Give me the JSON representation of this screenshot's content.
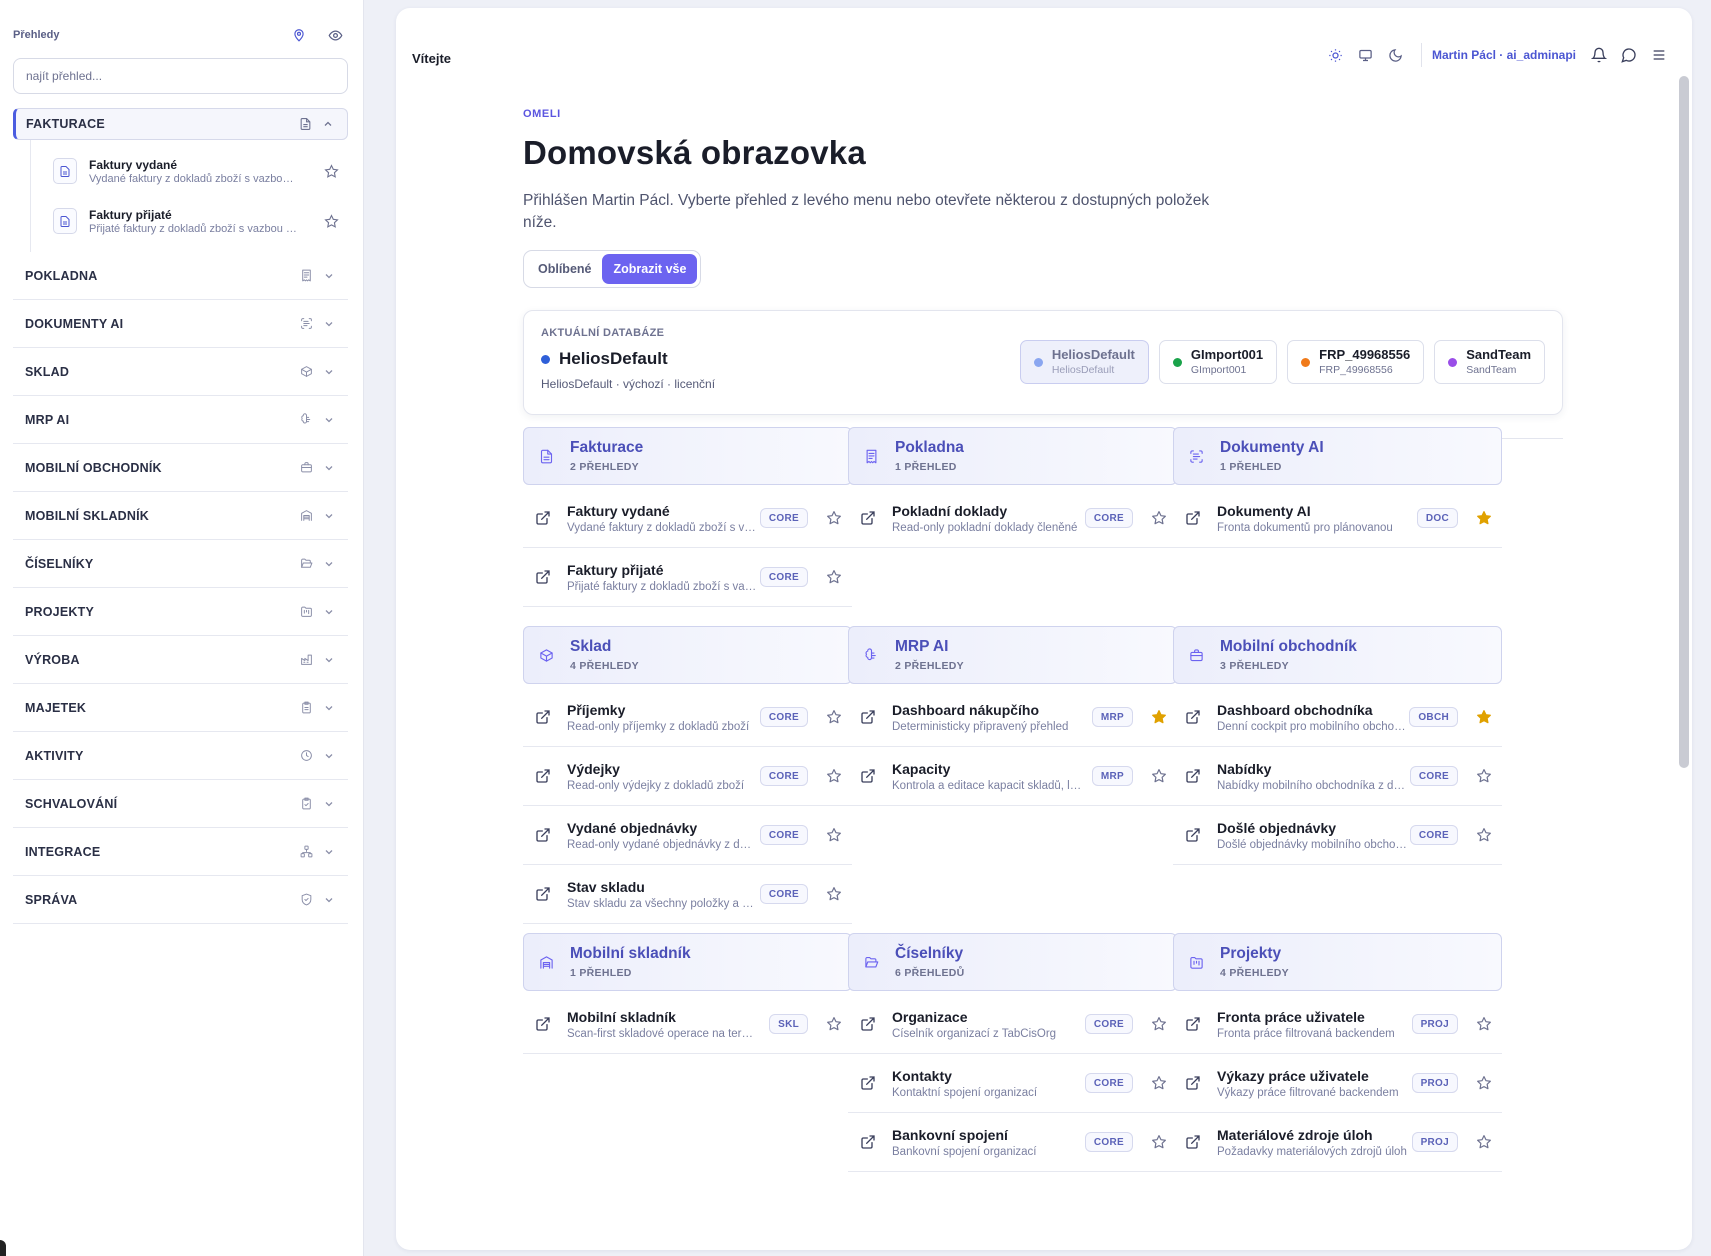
{
  "sidebar": {
    "title": "Přehledy",
    "search_placeholder": "najít přehled...",
    "open_group": {
      "label": "FAKTURACE",
      "items": [
        {
          "title": "Faktury vydané",
          "desc": "Vydané faktury z dokladů zboží s vazbou …"
        },
        {
          "title": "Faktury přijaté",
          "desc": "Přijaté faktury z dokladů zboží s vazbou …"
        }
      ]
    },
    "groups": [
      {
        "label": "POKLADNA",
        "icon": "receipt-icon"
      },
      {
        "label": "DOKUMENTY AI",
        "icon": "scan-text-icon"
      },
      {
        "label": "SKLAD",
        "icon": "box-icon"
      },
      {
        "label": "MRP AI",
        "icon": "brain-icon"
      },
      {
        "label": "MOBILNÍ OBCHODNÍK",
        "icon": "briefcase-icon"
      },
      {
        "label": "MOBILNÍ SKLADNÍK",
        "icon": "warehouse-icon"
      },
      {
        "label": "ČÍSELNÍKY",
        "icon": "folder-open-icon"
      },
      {
        "label": "PROJEKTY",
        "icon": "folder-kanban-icon"
      },
      {
        "label": "VÝROBA",
        "icon": "factory-icon"
      },
      {
        "label": "MAJETEK",
        "icon": "clipboard-icon"
      },
      {
        "label": "AKTIVITY",
        "icon": "clock-icon"
      },
      {
        "label": "SCHVALOVÁNÍ",
        "icon": "clipboard-check-icon"
      },
      {
        "label": "INTEGRACE",
        "icon": "network-icon"
      },
      {
        "label": "SPRÁVA",
        "icon": "shield-check-icon"
      }
    ]
  },
  "header": {
    "welcome": "Vítejte",
    "user": "Martin Pácl · ai_adminapi"
  },
  "page": {
    "eyebrow": "OMELI",
    "title": "Domovská obrazovka",
    "lead": "Přihlášen Martin Pácl. Vyberte přehled z levého menu nebo otevřete některou z dostupných položek níže.",
    "tabs": [
      "Oblíbené",
      "Zobrazit vše"
    ],
    "active_tab": "Zobrazit vše"
  },
  "database": {
    "eyebrow": "AKTUÁLNÍ DATABÁZE",
    "current": "HeliosDefault",
    "current_color": "#2f5fd8",
    "meta": "HeliosDefault · výchozí · licenční",
    "options": [
      {
        "name": "HeliosDefault",
        "sub": "HeliosDefault",
        "color": "#8aa6f0",
        "active": true
      },
      {
        "name": "GImport001",
        "sub": "GImport001",
        "color": "#1aa34a",
        "active": false
      },
      {
        "name": "FRP_49968556",
        "sub": "FRP_49968556",
        "color": "#f07a1a",
        "active": false
      },
      {
        "name": "SandTeam",
        "sub": "SandTeam",
        "color": "#9a4ee8",
        "active": false
      }
    ]
  },
  "categories": [
    {
      "title": "Fakturace",
      "count": "2 PŘEHLEDY",
      "icon": "file-text-icon",
      "items": [
        {
          "title": "Faktury vydané",
          "desc": "Vydané faktury z dokladů zboží s vazbou",
          "badge": "CORE",
          "fav": false
        },
        {
          "title": "Faktury přijaté",
          "desc": "Přijaté faktury z dokladů zboží s vazbou",
          "badge": "CORE",
          "fav": false
        }
      ]
    },
    {
      "title": "Pokladna",
      "count": "1 PŘEHLED",
      "icon": "receipt-icon",
      "items": [
        {
          "title": "Pokladní doklady",
          "desc": "Read-only pokladní doklady členěné",
          "badge": "CORE",
          "fav": false
        }
      ]
    },
    {
      "title": "Dokumenty AI",
      "count": "1 PŘEHLED",
      "icon": "scan-text-icon",
      "items": [
        {
          "title": "Dokumenty AI",
          "desc": "Fronta dokumentů pro plánovanou",
          "badge": "DOC",
          "fav": true
        }
      ]
    },
    {
      "title": "Sklad",
      "count": "4 PŘEHLEDY",
      "icon": "box-icon",
      "items": [
        {
          "title": "Příjemky",
          "desc": "Read-only příjemky z dokladů zboží",
          "badge": "CORE",
          "fav": false
        },
        {
          "title": "Výdejky",
          "desc": "Read-only výdejky z dokladů zboží",
          "badge": "CORE",
          "fav": false
        },
        {
          "title": "Vydané objednávky",
          "desc": "Read-only vydané objednávky z dokladů",
          "badge": "CORE",
          "fav": false
        },
        {
          "title": "Stav skladu",
          "desc": "Stav skladu za všechny položky a sklady",
          "badge": "CORE",
          "fav": false
        }
      ]
    },
    {
      "title": "MRP AI",
      "count": "2 PŘEHLEDY",
      "icon": "brain-icon",
      "items": [
        {
          "title": "Dashboard nákupčího",
          "desc": "Deterministicky připravený přehled",
          "badge": "MRP",
          "fav": true
        },
        {
          "title": "Kapacity",
          "desc": "Kontrola a editace kapacit skladů, linek",
          "badge": "MRP",
          "fav": false
        }
      ]
    },
    {
      "title": "Mobilní obchodník",
      "count": "3 PŘEHLEDY",
      "icon": "briefcase-icon",
      "items": [
        {
          "title": "Dashboard obchodníka",
          "desc": "Denní cockpit pro mobilního obchodníka",
          "badge": "OBCH",
          "fav": true
        },
        {
          "title": "Nabídky",
          "desc": "Nabídky mobilního obchodníka z dokladů",
          "badge": "CORE",
          "fav": false
        },
        {
          "title": "Došlé objednávky",
          "desc": "Došlé objednávky mobilního obchodníka",
          "badge": "CORE",
          "fav": false
        }
      ]
    },
    {
      "title": "Mobilní skladník",
      "count": "1 PŘEHLED",
      "icon": "warehouse-icon",
      "items": [
        {
          "title": "Mobilní skladník",
          "desc": "Scan-first skladové operace na terminálu",
          "badge": "SKL",
          "fav": false
        }
      ]
    },
    {
      "title": "Číselníky",
      "count": "6 PŘEHLEDŮ",
      "icon": "folder-open-icon",
      "items": [
        {
          "title": "Organizace",
          "desc": "Číselník organizací z TabCisOrg",
          "badge": "CORE",
          "fav": false
        },
        {
          "title": "Kontakty",
          "desc": "Kontaktní spojení organizací",
          "badge": "CORE",
          "fav": false
        },
        {
          "title": "Bankovní spojení",
          "desc": "Bankovní spojení organizací",
          "badge": "CORE",
          "fav": false
        }
      ]
    },
    {
      "title": "Projekty",
      "count": "4 PŘEHLEDY",
      "icon": "folder-kanban-icon",
      "items": [
        {
          "title": "Fronta práce uživatele",
          "desc": "Fronta práce filtrovaná backendem",
          "badge": "PROJ",
          "fav": false
        },
        {
          "title": "Výkazy práce uživatele",
          "desc": "Výkazy práce filtrované backendem",
          "badge": "PROJ",
          "fav": false
        },
        {
          "title": "Materiálové zdroje úloh",
          "desc": "Požadavky materiálových zdrojů úloh",
          "badge": "PROJ",
          "fav": false
        }
      ]
    }
  ],
  "colors": {
    "accent": "#6c63f0",
    "star_fav": "#e0a100",
    "category_title": "#4b4fb8"
  }
}
